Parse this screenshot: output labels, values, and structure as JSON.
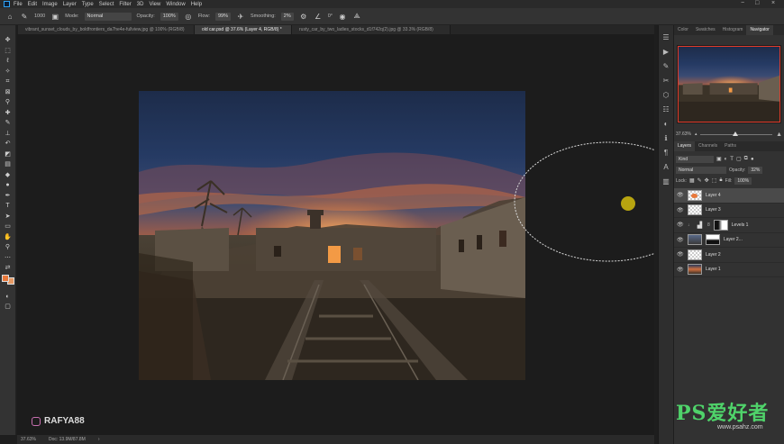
{
  "menu": [
    "File",
    "Edit",
    "Image",
    "Layer",
    "Type",
    "Select",
    "Filter",
    "3D",
    "View",
    "Window",
    "Help"
  ],
  "window_controls": [
    "−",
    "□",
    "×"
  ],
  "options": {
    "brush_size": "1000",
    "mode_label": "Mode:",
    "mode_value": "Normal",
    "opacity_label": "Opacity:",
    "opacity_value": "100%",
    "flow_label": "Flow:",
    "flow_value": "99%",
    "smoothing_label": "Smoothing:",
    "smoothing_value": "2%",
    "angle_value": "0°"
  },
  "tabs": [
    {
      "label": "vibrant_sunset_clouds_by_boldfrontiers_da7he4e-fullview.jpg @ 100% (RGB/8)",
      "active": false
    },
    {
      "label": "old car.psd @ 37.6% (Layer 4, RGB/8) *",
      "active": true
    },
    {
      "label": "rusty_car_by_two_ladies_stocks_d1f742q(2).jpg @ 33.3% (RGB/8)",
      "active": false
    }
  ],
  "status": {
    "zoom": "37.63%",
    "doc": "Doc: 13.9M/87.8M"
  },
  "watermark": {
    "handle": "RAFYA88"
  },
  "panel_tabs": [
    {
      "label": "Color",
      "active": false
    },
    {
      "label": "Swatches",
      "active": false
    },
    {
      "label": "Histogram",
      "active": false
    },
    {
      "label": "Navigator",
      "active": true
    }
  ],
  "navigator": {
    "zoom": "37.63%"
  },
  "layer_tabs": [
    {
      "label": "Layers",
      "active": true
    },
    {
      "label": "Channels",
      "active": false
    },
    {
      "label": "Paths",
      "active": false
    }
  ],
  "layer_controls": {
    "kind": "Kind",
    "blend": "Normal",
    "opacity_label": "Opacity:",
    "opacity_value": "32%",
    "lock_label": "Lock:",
    "fill_label": "Fill:",
    "fill_value": "100%"
  },
  "layers": [
    {
      "name": "Layer 4",
      "selected": true
    },
    {
      "name": "Layer 3",
      "selected": false
    },
    {
      "name": "Levels 1",
      "selected": false
    },
    {
      "name": "Layer 2...",
      "selected": false
    },
    {
      "name": "Layer 2",
      "selected": false
    },
    {
      "name": "Layer 1",
      "selected": false
    }
  ],
  "site_watermark": {
    "brand": "PS爱好者",
    "url": "www.psahz.com"
  },
  "colors": {
    "foreground": "#e8783a",
    "background": "#e59964",
    "brush_cursor": "#b7a410"
  }
}
